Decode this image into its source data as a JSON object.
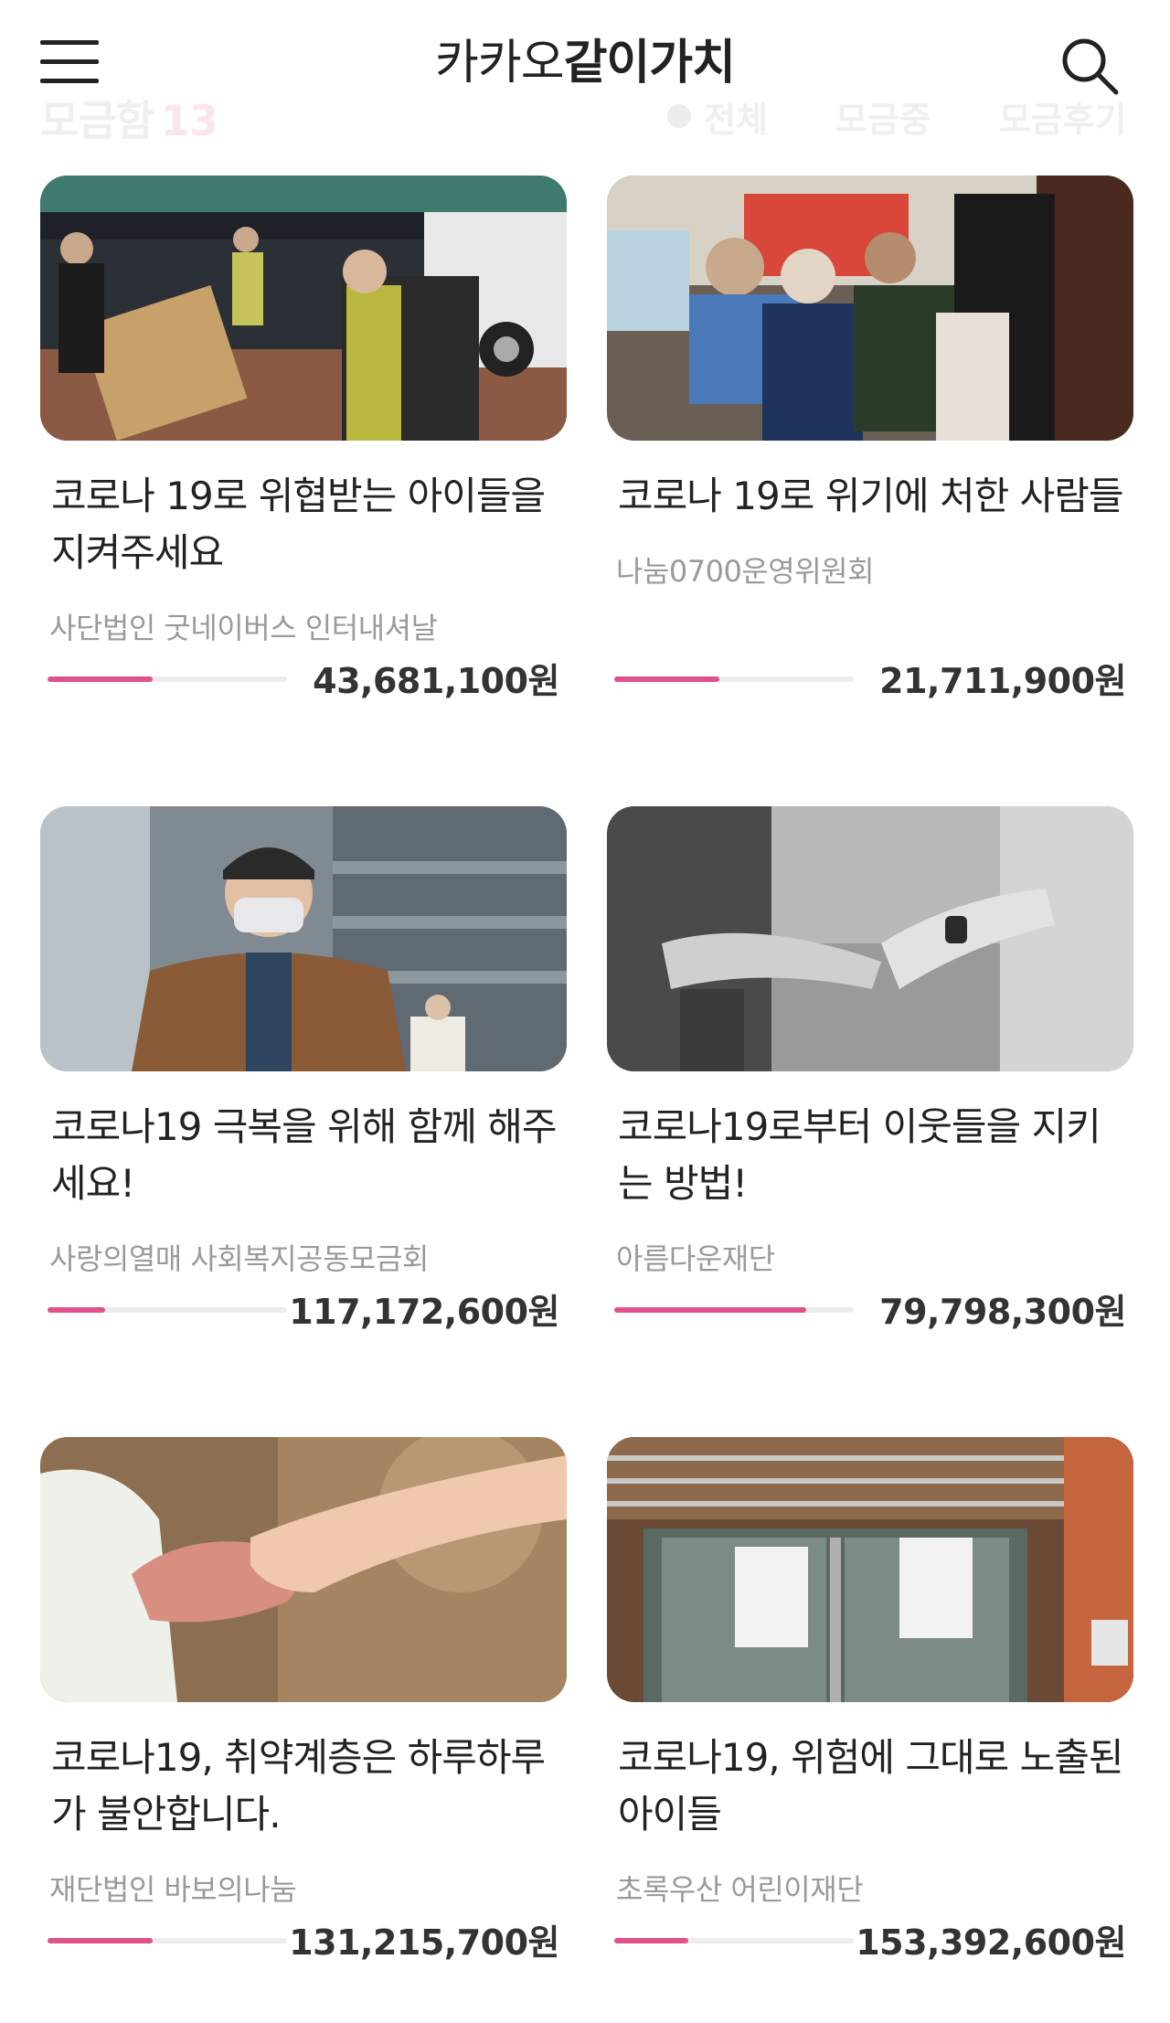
{
  "header": {
    "logo_part1": "카카오",
    "logo_part2": "같이가치",
    "menu_icon": "hamburger-menu-icon",
    "search_icon": "search-icon"
  },
  "subbar": {
    "title": "모금함",
    "count": "13",
    "filters": [
      "전체",
      "모금중",
      "모금후기"
    ]
  },
  "colors": {
    "accent": "#e0528b",
    "progress_track": "#ededed",
    "org_text": "#9a9a9a"
  },
  "campaigns": [
    {
      "title": "코로나 19로 위협받는 아이들을 지켜주세요",
      "org": "사단법인 굿네이버스 인터내셔날",
      "amount": "43,681,100원",
      "progress": 0.44
    },
    {
      "title": "코로나 19로 위기에 처한 사람들",
      "org": "나눔0700운영위원회",
      "amount": "21,711,900원",
      "progress": 0.44
    },
    {
      "title": "코로나19 극복을 위해 함께 해주세요!",
      "org": "사랑의열매 사회복지공동모금회",
      "amount": "117,172,600원",
      "progress": 0.24
    },
    {
      "title": "코로나19로부터 이웃들을 지키는 방법!",
      "org": "아름다운재단",
      "amount": "79,798,300원",
      "progress": 0.8
    },
    {
      "title": "코로나19, 취약계층은 하루하루가 불안합니다.",
      "org": "재단법인 바보의나눔",
      "amount": "131,215,700원",
      "progress": 0.44
    },
    {
      "title": "코로나19, 위험에 그대로 노출된 아이들",
      "org": "초록우산 어린이재단",
      "amount": "153,392,600원",
      "progress": 0.31
    }
  ]
}
